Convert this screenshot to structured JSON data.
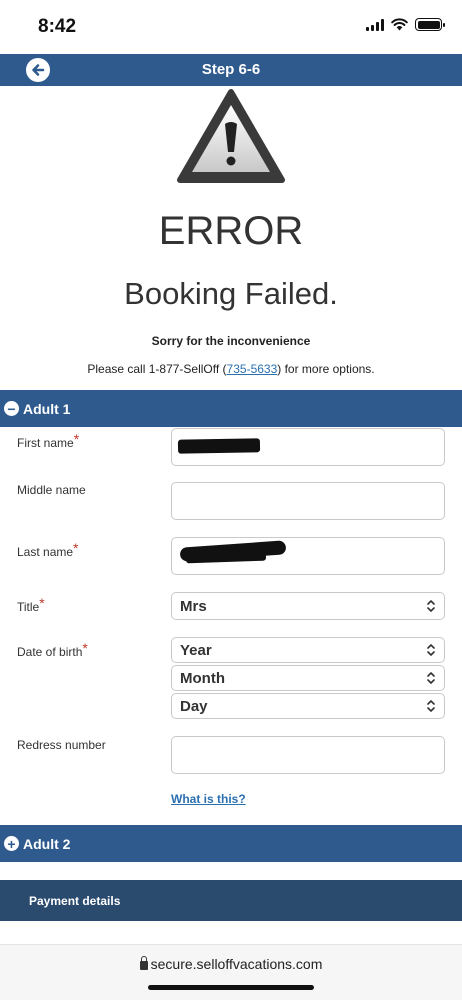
{
  "status_bar": {
    "time": "8:42"
  },
  "header": {
    "step_title": "Step 6-6"
  },
  "error": {
    "heading": "ERROR",
    "subheading": "Booking Failed.",
    "sorry": "Sorry for the inconvenience",
    "call_prefix": "Please call 1-877-SellOff (",
    "call_link": "735-5633",
    "call_suffix": ") for more options."
  },
  "adult1": {
    "title": "Adult 1",
    "icon": "minus-circle-icon",
    "fields": {
      "first_name_label": "First name",
      "middle_name_label": "Middle name",
      "last_name_label": "Last name",
      "title_label": "Title",
      "title_value": "Mrs",
      "dob_label": "Date of birth",
      "dob_year": "Year",
      "dob_month": "Month",
      "dob_day": "Day",
      "redress_label": "Redress number",
      "what_is_this": "What is this?"
    },
    "required_mark": "*"
  },
  "adult2": {
    "title": "Adult 2",
    "icon": "plus-circle-icon"
  },
  "payment": {
    "title": "Payment details"
  },
  "browser": {
    "url": "secure.selloffvacations.com"
  },
  "colors": {
    "header_blue": "#2f5a8e",
    "payment_blue": "#2a4a6e",
    "link_blue": "#2a6fb0",
    "required_red": "#c0392b"
  }
}
